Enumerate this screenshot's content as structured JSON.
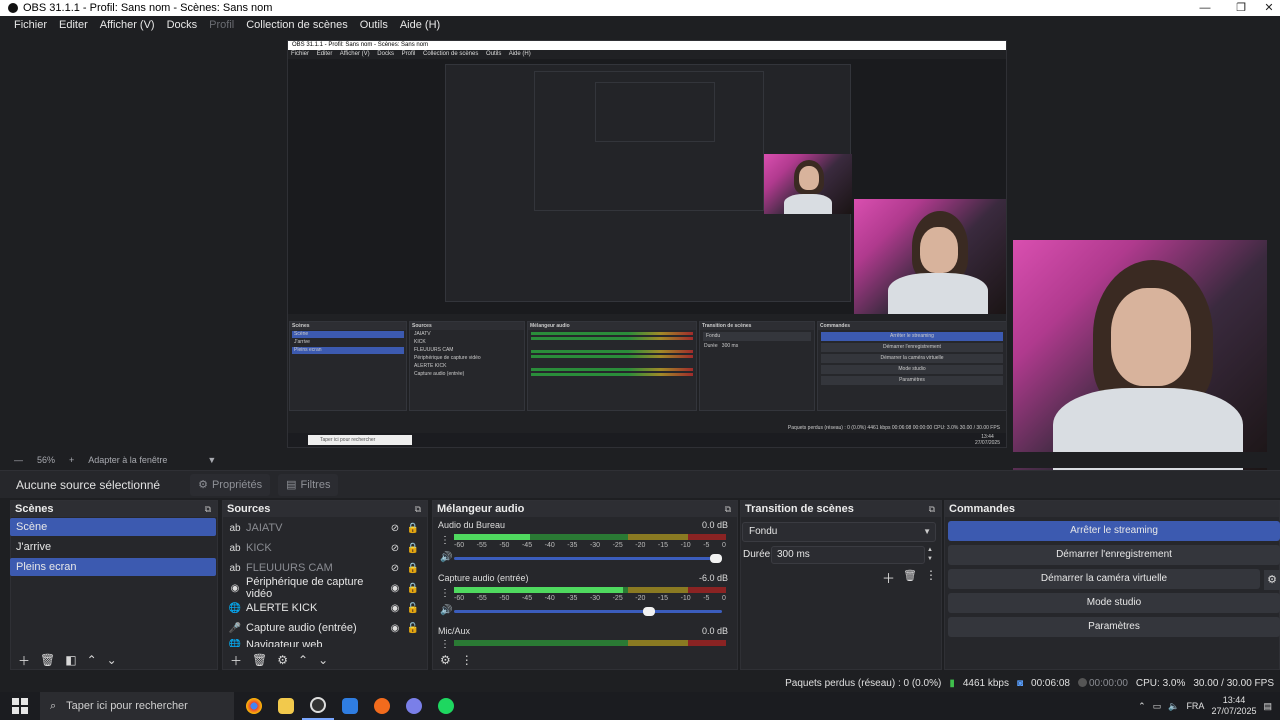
{
  "window": {
    "title": "OBS 31.1.1 - Profil: Sans nom - Scènes: Sans nom",
    "minimize": "—",
    "restore": "❐",
    "close": "✕"
  },
  "menu": {
    "items": [
      "Fichier",
      "Editer",
      "Afficher (V)",
      "Docks",
      "Profil",
      "Collection de scènes",
      "Outils",
      "Aide (H)"
    ]
  },
  "inner_preview": {
    "title": "OBS 31.1.1 - Profil: Sans nom - Scènes: Sans nom",
    "menu": [
      "Fichier",
      "Editer",
      "Afficher (V)",
      "Docks",
      "Profil",
      "Collection de scènes",
      "Outils",
      "Aide (H)"
    ],
    "zoom": "56%",
    "fit": "Adapter à la fenêtre",
    "no_source": "Aucune source sélectionné",
    "props": "Propriétés",
    "filters": "Filtres",
    "scenes_title": "Scènes",
    "sources_title": "Sources",
    "mixer_title": "Mélangeur audio",
    "transition_title": "Transition de scènes",
    "commands_title": "Commandes",
    "scenes": [
      "Scène",
      "J'arrive",
      "Pleins ecran"
    ],
    "sources": [
      "JAIATV",
      "KICK",
      "FLEUUURS CAM",
      "Périphérique de capture vidéo",
      "ALERTE KICK",
      "Capture audio (entrée)"
    ],
    "commands": [
      "Arrêter le streaming",
      "Démarrer l'enregistrement",
      "Démarrer la caméra virtuelle",
      "Mode studio",
      "Paramètres"
    ],
    "status": "Paquets perdus (réseau) : 0 (0.0%)   4461 kbps   00:06:08   00:00:00   CPU: 3.0%   30.00 / 30.00 FPS",
    "search": "Taper ici pour rechercher",
    "fondu": "Fondu",
    "duree": "Durée",
    "duree_val": "300 ms",
    "clock_time": "13:44",
    "clock_date": "27/07/2025",
    "lang": "FRA"
  },
  "zoom": {
    "minus": "—",
    "value": "56%",
    "plus": "+",
    "fit_label": "Adapter à la fenêtre"
  },
  "props_bar": {
    "no_source": "Aucune source sélectionné",
    "properties_label": "Propriétés",
    "filters_label": "Filtres"
  },
  "scenes": {
    "title": "Scènes",
    "items": [
      {
        "label": "Scène",
        "selected": true
      },
      {
        "label": "J'arrive",
        "selected": false
      },
      {
        "label": "Pleins ecran",
        "selected": true
      }
    ]
  },
  "sources": {
    "title": "Sources",
    "items": [
      {
        "label": "JAIATV",
        "icon": "text-icon",
        "visible": false,
        "locked": true
      },
      {
        "label": "KICK",
        "icon": "text-icon",
        "visible": false,
        "locked": true
      },
      {
        "label": "FLEUUURS CAM",
        "icon": "text-icon",
        "visible": false,
        "locked": true
      },
      {
        "label": "Périphérique de capture vidéo",
        "icon": "camera-icon",
        "visible": true,
        "locked": true
      },
      {
        "label": "ALERTE KICK",
        "icon": "globe-icon",
        "visible": true,
        "locked": false
      },
      {
        "label": "Capture audio (entrée)",
        "icon": "mic-icon",
        "visible": true,
        "locked": false
      },
      {
        "label": "Navigateur web",
        "icon": "globe-icon",
        "visible": true,
        "locked": false
      }
    ]
  },
  "mixer": {
    "title": "Mélangeur audio",
    "channels": [
      {
        "name": "Audio du Bureau",
        "db": "0.0 dB",
        "level": 0.28,
        "volume": 1.0
      },
      {
        "name": "Capture audio (entrée)",
        "db": "-6.0 dB",
        "level": 0.62,
        "volume": 0.75
      },
      {
        "name": "Mic/Aux",
        "db": "0.0 dB",
        "level": 0.0,
        "volume": 1.0
      }
    ],
    "ticks": [
      "-60",
      "-55",
      "-50",
      "-45",
      "-40",
      "-35",
      "-30",
      "-25",
      "-20",
      "-15",
      "-10",
      "-5",
      "0"
    ]
  },
  "transition": {
    "title": "Transition de scènes",
    "selected": "Fondu",
    "duration_label": "Durée",
    "duration_value": "300 ms"
  },
  "commands": {
    "title": "Commandes",
    "buttons": [
      "Arrêter le streaming",
      "Démarrer l'enregistrement",
      "Démarrer la caméra virtuelle",
      "Mode studio",
      "Paramètres"
    ]
  },
  "status": {
    "dropped": "Paquets perdus (réseau) : 0 (0.0%)",
    "bitrate": "4461 kbps",
    "stream_time": "00:06:08",
    "rec_time": "00:00:00",
    "cpu": "CPU: 3.0%",
    "fps": "30.00 / 30.00 FPS"
  },
  "taskbar": {
    "search_placeholder": "Taper ici pour rechercher",
    "apps": [
      "chrome-icon",
      "explorer-icon",
      "obs-icon",
      "store-icon",
      "origin-icon",
      "discord-icon",
      "spotify-icon"
    ],
    "lang": "FRA",
    "time": "13:44",
    "date": "27/07/2025"
  },
  "colors": {
    "accent": "#3c5ab0",
    "background": "#1e1f22",
    "panel": "#26272b",
    "meter_green": "#4fd95f"
  }
}
